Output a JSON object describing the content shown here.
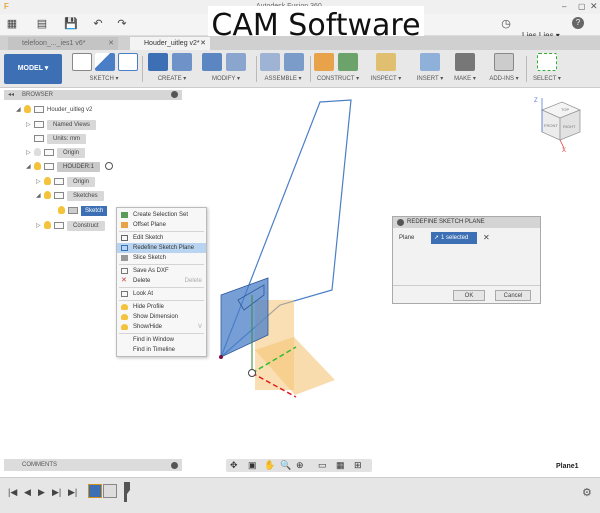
{
  "titlebar": {
    "title": "Autodesk Fusion 360"
  },
  "banner": {
    "text": "CAM Software"
  },
  "menubar": {
    "user": "Lies Lies ▾",
    "help": "?"
  },
  "tabs": [
    {
      "label": "telefoon_..._ies1 v6*"
    },
    {
      "label": "Houder_uitleg v2*"
    }
  ],
  "toolbar": {
    "model": "MODEL ▾",
    "groups": [
      {
        "label": "SKETCH ▾"
      },
      {
        "label": "CREATE ▾"
      },
      {
        "label": "MODIFY ▾"
      },
      {
        "label": "ASSEMBLE ▾"
      },
      {
        "label": "CONSTRUCT ▾"
      },
      {
        "label": "INSPECT ▾"
      },
      {
        "label": "INSERT ▾"
      },
      {
        "label": "MAKE ▾"
      },
      {
        "label": "ADD-INS ▾"
      },
      {
        "label": "SELECT ▾"
      }
    ]
  },
  "browser": {
    "header": "BROWSER",
    "tree": [
      {
        "label": "Houder_uitleg v2"
      },
      {
        "label": "Named Views"
      },
      {
        "label": "Units: mm"
      },
      {
        "label": "Origin"
      },
      {
        "label": "HOUDER:1"
      },
      {
        "label": "Origin"
      },
      {
        "label": "Sketches"
      },
      {
        "label": "Sketch"
      },
      {
        "label": "Construct"
      }
    ]
  },
  "context_menu": {
    "items": [
      {
        "label": "Create Selection Set",
        "shortcut": ""
      },
      {
        "label": "Offset Plane",
        "shortcut": ""
      },
      {
        "label": "Edit Sketch",
        "shortcut": ""
      },
      {
        "label": "Redefine Sketch Plane",
        "shortcut": ""
      },
      {
        "label": "Slice Sketch",
        "shortcut": ""
      },
      {
        "label": "Save As DXF",
        "shortcut": ""
      },
      {
        "label": "Delete",
        "shortcut": "Delete"
      },
      {
        "label": "Look At",
        "shortcut": ""
      },
      {
        "label": "Hide Profile",
        "shortcut": ""
      },
      {
        "label": "Show Dimension",
        "shortcut": ""
      },
      {
        "label": "Show/Hide",
        "shortcut": "V"
      },
      {
        "label": "Find in Window",
        "shortcut": ""
      },
      {
        "label": "Find in Timeline",
        "shortcut": ""
      }
    ]
  },
  "panel": {
    "title": "REDEFINE SKETCH PLANE",
    "field_label": "Plane",
    "selection": "1 selected",
    "ok": "OK",
    "cancel": "Cancel"
  },
  "viewcube": {
    "top": "TOP",
    "front": "FRONT",
    "right": "RIGHT",
    "z": "Z",
    "x": "X"
  },
  "comments": {
    "label": "COMMENTS"
  },
  "status": {
    "selection_name": "Plane1"
  },
  "colors": {
    "accent": "#3c6fb3",
    "highlight": "#b8d4f0",
    "plane": "#f5c476",
    "sketch": "#4a7fc8"
  }
}
